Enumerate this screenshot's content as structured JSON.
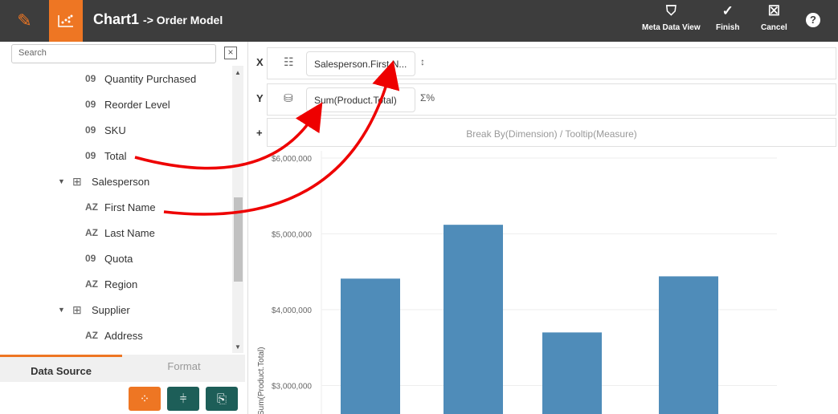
{
  "header": {
    "title": "Chart1",
    "subtitle": "-> Order Model",
    "buttons": [
      {
        "label": "Meta Data View",
        "icon": "tag-icon"
      },
      {
        "label": "Finish",
        "icon": "check-circle-icon"
      },
      {
        "label": "Cancel",
        "icon": "close-box-icon"
      }
    ],
    "help": "?"
  },
  "sidebar": {
    "search_placeholder": "Search",
    "items": [
      {
        "type": "09",
        "label": "Quantity Purchased"
      },
      {
        "type": "09",
        "label": "Reorder Level"
      },
      {
        "type": "09",
        "label": "SKU"
      },
      {
        "type": "09",
        "label": "Total"
      },
      {
        "type": "table",
        "label": "Salesperson"
      },
      {
        "type": "AZ",
        "label": "First Name"
      },
      {
        "type": "AZ",
        "label": "Last Name"
      },
      {
        "type": "09",
        "label": "Quota"
      },
      {
        "type": "AZ",
        "label": "Region"
      },
      {
        "type": "table",
        "label": "Supplier"
      },
      {
        "type": "AZ",
        "label": "Address"
      }
    ],
    "tabs": [
      {
        "label": "Data Source",
        "active": true
      },
      {
        "label": "Format",
        "active": false
      }
    ],
    "accent": "#ee7623",
    "teal": "#1d5e58"
  },
  "shelves": {
    "x": {
      "label": "X",
      "value": "Salesperson.First N..."
    },
    "y": {
      "label": "Y",
      "value": "Sum(Product.Total)",
      "side": "Σ%"
    },
    "plus": {
      "label": "+",
      "placeholder": "Break By(Dimension) / Tooltip(Measure)"
    }
  },
  "chart_data": {
    "type": "bar",
    "categories": [
      "",
      "",
      "",
      ""
    ],
    "values": [
      4410000,
      5120000,
      3700000,
      4440000
    ],
    "ylabel": "Sum(Product.Total)",
    "yticks": [
      "$3,000,000",
      "$4,000,000",
      "$5,000,000",
      "$6,000,000"
    ],
    "ytick_values": [
      3000000,
      4000000,
      5000000,
      6000000
    ],
    "ylim_visible": [
      2630000,
      6000000
    ],
    "color": "#4f8cb9",
    "grid": true
  }
}
